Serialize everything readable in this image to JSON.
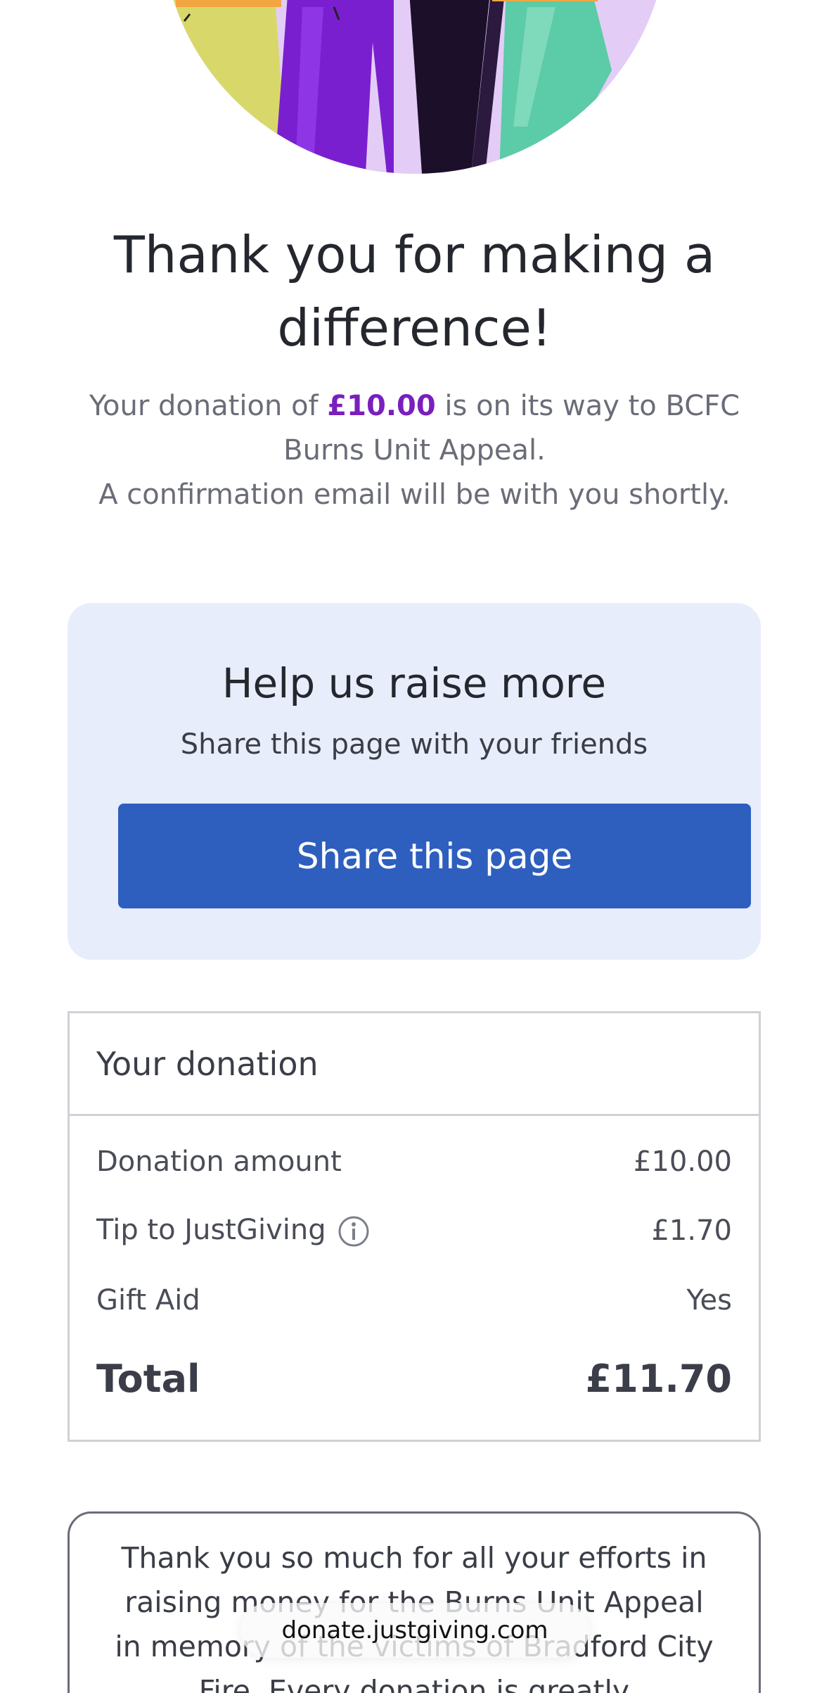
{
  "hero": {
    "illustration_icon": "people-illustration",
    "colors": {
      "background": "#e3cdf6",
      "purple": "#7a1fd0",
      "dark": "#1c0f2a",
      "green": "#5ccba7",
      "yellow": "#d8d86a",
      "orange": "#f2a640"
    }
  },
  "headline": {
    "line1": "Thank you for making a",
    "line2": "difference!"
  },
  "confirmation": {
    "prefix": "Your donation of ",
    "amount": "£10.00",
    "suffix": " is on its way to BCFC",
    "line2": "Burns Unit Appeal.",
    "line3": "A confirmation email will be with you shortly."
  },
  "share": {
    "title": "Help us raise more",
    "subtitle": "Share this page with your friends",
    "button_label": "Share this page",
    "button_color": "#2e5fbf",
    "card_color": "#e8edfb"
  },
  "summary": {
    "title": "Your donation",
    "rows": [
      {
        "label": "Donation amount",
        "value": "£10.00"
      },
      {
        "label": "Tip to JustGiving",
        "value": "£1.70",
        "icon": "info-icon"
      },
      {
        "label": "Gift Aid",
        "value": "Yes"
      }
    ],
    "total_label": "Total",
    "total_value": "£11.70"
  },
  "message": {
    "text": "Thank you so much for all your efforts in raising money for the Burns Unit Appeal in memory of the victims of Bradford City Fire. Every donation is greatly"
  },
  "browser": {
    "url": "donate.justgiving.com"
  }
}
